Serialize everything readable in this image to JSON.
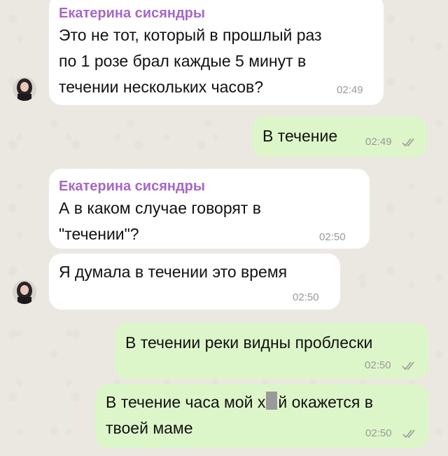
{
  "contact": {
    "name": "Екатерина сисяндры"
  },
  "messages": [
    {
      "direction": "in",
      "sender": "Екатерина сисяндры",
      "lines": [
        "Это не тот, который в прошлый раз",
        "по 1 розе брал каждые 5 минут в",
        "течении нескольких часов?"
      ],
      "time": "02:49"
    },
    {
      "direction": "out",
      "lines": [
        "В течение"
      ],
      "time": "02:49",
      "status": "read"
    },
    {
      "direction": "in",
      "sender": "Екатерина сисяндры",
      "lines": [
        "А в каком случае говорят в",
        "\"течении\"?"
      ],
      "time": "02:50"
    },
    {
      "direction": "in",
      "lines": [
        "Я думала в течении это время"
      ],
      "time": "02:50"
    },
    {
      "direction": "out",
      "lines": [
        "В течении реки видны проблески"
      ],
      "time": "02:50",
      "status": "read"
    },
    {
      "direction": "out",
      "text_parts": {
        "before": "В течение часа мой х",
        "after": "й окажется в"
      },
      "lines": [
        "твоей маме"
      ],
      "time": "02:50",
      "status": "read"
    }
  ],
  "colors": {
    "incoming_bubble": "#ffffff",
    "outgoing_bubble": "#ddf6c9",
    "sender_name": "#a667c8",
    "timestamp": "#999999",
    "background": "#ebe8e1"
  },
  "icons": {
    "read_receipt": "double-check-icon",
    "avatar": "avatar"
  }
}
